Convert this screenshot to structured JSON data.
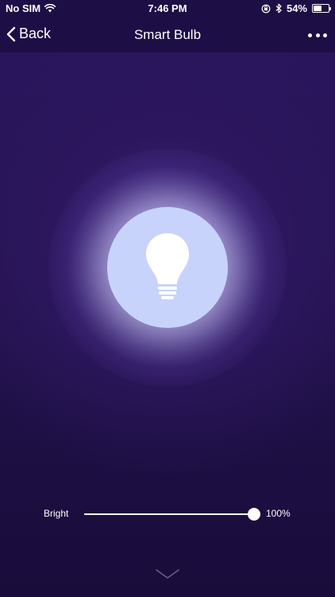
{
  "status_bar": {
    "carrier": "No SIM",
    "time": "7:46 PM",
    "battery_percent": "54%",
    "battery_level": 0.54,
    "icons": [
      "wifi-icon",
      "orientation-lock-icon",
      "bluetooth-icon",
      "battery-icon"
    ]
  },
  "nav": {
    "back_label": "Back",
    "title": "Smart Bulb",
    "more_icon": "more-dots-icon"
  },
  "bulb": {
    "icon": "light-bulb-icon",
    "circle_color": "#c8d3fb"
  },
  "brightness": {
    "label": "Bright",
    "value_text": "100%",
    "level": 1.0
  },
  "footer": {
    "icon": "chevron-down-icon"
  },
  "colors": {
    "background_top": "#2a1660",
    "background_bottom": "#190c3a",
    "bar": "#1d0f45"
  }
}
